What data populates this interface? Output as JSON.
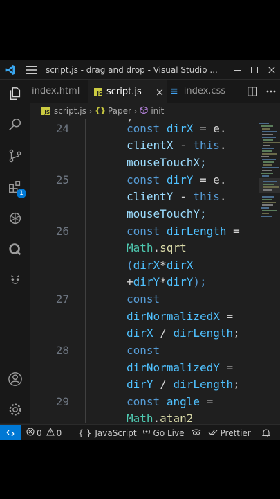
{
  "window": {
    "title": "script.js - drag and drop - Visual Studio ...",
    "accent": "#0078d4"
  },
  "tabs": [
    {
      "label": "index.html",
      "active": false
    },
    {
      "label": "script.js",
      "active": true,
      "close": "×"
    },
    {
      "label": "index.css",
      "active": false
    }
  ],
  "breadcrumb": {
    "file": "script.js",
    "item1": "Paper",
    "item2": "init"
  },
  "activity_badge": "1",
  "editor": {
    "line_numbers": [
      "24",
      "25",
      "26",
      "27",
      "28",
      "29"
    ],
    "top_fragment": ")",
    "code": {
      "l24a_kw": "const",
      "l24a_var": "dirX",
      "l24a_rest": " = e.",
      "l24b_prop": "clientX",
      "l24b_op": " - ",
      "l24b_kw": "this",
      "l24b_dot": ".",
      "l24c": "mouseTouchX;",
      "l25a_kw": "const",
      "l25a_var": "dirY",
      "l25a_rest": " = e.",
      "l25b_prop": "clientY",
      "l25b_op": " - ",
      "l25b_kw": "this",
      "l25b_dot": ".",
      "l25c": "mouseTouchY;",
      "l26a_kw": "const",
      "l26a_var": "dirLength",
      "l26a_rest": " =",
      "l26b_cls": "Math",
      "l26b_dot": ".",
      "l26b_fn": "sqrt",
      "l26c_paren": "(",
      "l26c_a": "dirX",
      "l26c_op": "*",
      "l26c_b": "dirX",
      "l26d_op": "+",
      "l26d_a": "dirY",
      "l26d_op2": "*",
      "l26d_b": "dirY",
      "l26d_end": ");",
      "l27a_kw": "const",
      "l27b_var": "dirNormalizedX",
      "l27b_rest": " =",
      "l27c_a": "dirX",
      "l27c_op": " / ",
      "l27c_b": "dirLength",
      "l27c_end": ";",
      "l28a_kw": "const",
      "l28b_var": "dirNormalizedY",
      "l28b_rest": " =",
      "l28c_a": "dirY",
      "l28c_op": " / ",
      "l28c_b": "dirLength",
      "l28c_end": ";",
      "l29a_kw": "const",
      "l29a_var": "angle",
      "l29a_rest": " =",
      "l29b_cls": "Math",
      "l29b_dot": ".",
      "l29b_fn": "atan2"
    }
  },
  "status": {
    "errors": "0",
    "warnings": "0",
    "language": "JavaScript",
    "golive": "Go Live",
    "prettier": "Prettier"
  }
}
